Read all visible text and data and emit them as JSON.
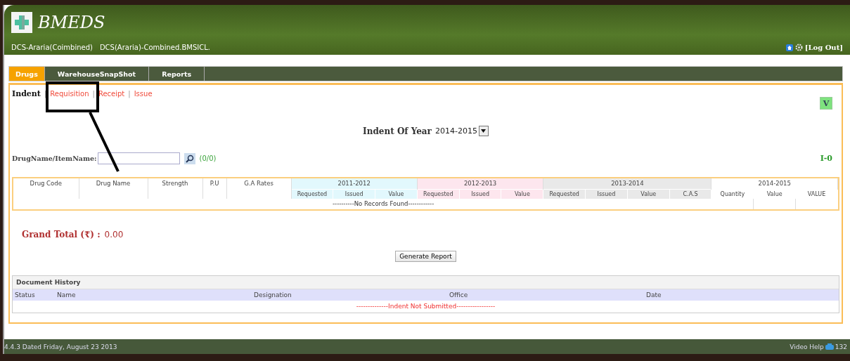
{
  "header": {
    "logo_text": "BMEDS",
    "user_line": [
      "DCS-Araria(Coimbined)",
      "DCS(Araria)-Combined.BMSICL."
    ],
    "logout": "[Log Out]"
  },
  "tabs": [
    {
      "label": "Drugs",
      "selected": true
    },
    {
      "label": "WarehouseSnapShot",
      "selected": false
    },
    {
      "label": "Reports",
      "selected": false
    }
  ],
  "subnav_separator": "|",
  "subnav": [
    {
      "label": "Indent",
      "selected": true
    },
    {
      "label": "Requisition",
      "selected": false
    },
    {
      "label": "Receipt",
      "selected": false
    },
    {
      "label": "Issue",
      "selected": false
    }
  ],
  "v_button": "V",
  "year": {
    "label": "Indent Of Year",
    "value": "2014-2015"
  },
  "search": {
    "label": "DrugName/ItemName:",
    "count": "(0/0)"
  },
  "counter": "I-0",
  "table": {
    "columns": [
      "Drug Code",
      "Drug Name",
      "Strength",
      "P.U",
      "G.A Rates"
    ],
    "groups": [
      {
        "label": "2011-2012",
        "color": "#e2f8fd",
        "columns": [
          "Requested",
          "Issued",
          "Value"
        ]
      },
      {
        "label": "2012-2013",
        "color": "#fde6ee",
        "columns": [
          "Requested",
          "Issued",
          "Value"
        ]
      },
      {
        "label": "2013-2014",
        "color": "#e9e9e9",
        "columns": [
          "Requested",
          "Issued",
          "Value",
          "C.A.S"
        ]
      },
      {
        "label": "2014-2015",
        "color": "#ffffff",
        "columns": [
          "Quantity",
          "Value",
          "VALUE"
        ]
      }
    ],
    "empty": "----------No Records Found------------"
  },
  "grand_total": {
    "label": "Grand Total (₹) :",
    "value": "0.00"
  },
  "generate_button": "Generate Report",
  "history": {
    "title": "Document History",
    "columns": [
      "Status",
      "Name",
      "Designation",
      "Office",
      "Date"
    ],
    "empty": "--------------Indent Not Submitted-----------------"
  },
  "footer": {
    "version": "4.4.3 Dated Friday, August 23 2013",
    "help": "Video Help",
    "count": "132"
  }
}
